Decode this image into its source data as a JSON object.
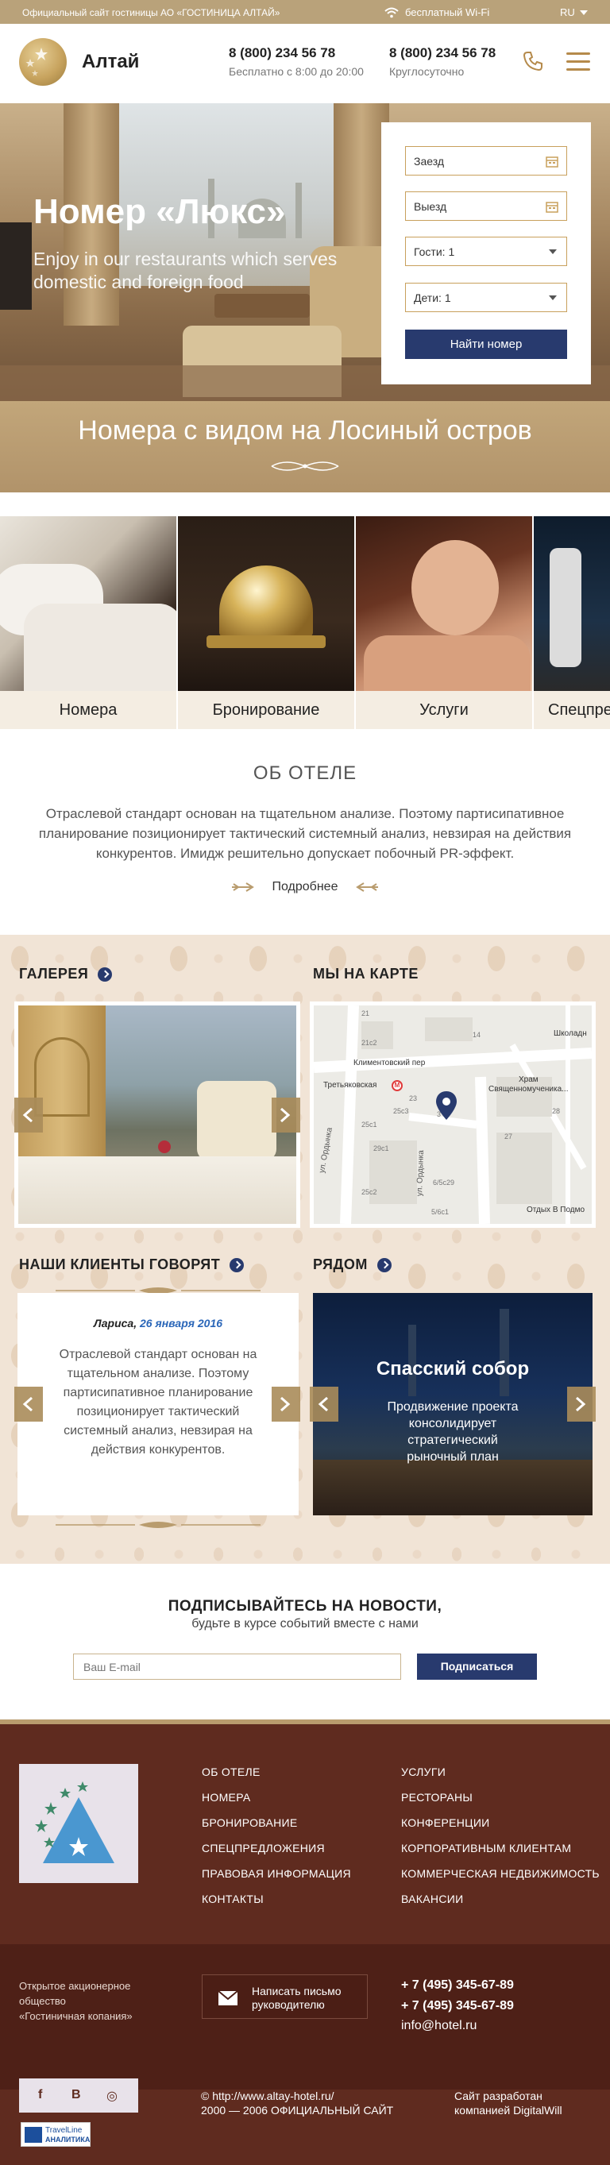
{
  "topbar": {
    "official": "Официальный сайт гостиницы АО «ГОСТИНИЦА АЛТАЙ»",
    "wifi": "бесплатный Wi-Fi",
    "lang": "RU"
  },
  "header": {
    "logo_text": "Алтай",
    "phones": [
      {
        "number": "8 (800) 234 56 78",
        "note": "Бесплатно с 8:00 до 20:00"
      },
      {
        "number": "8 (800) 234 56 78",
        "note": "Круглосуточно"
      }
    ],
    "icons": [
      "phone-icon",
      "menu-icon"
    ]
  },
  "hero": {
    "title": "Номер «Люкс»",
    "subtitle": "Enjoy in our restaurants which serves domestic and foreign food",
    "booking": {
      "checkin": "Заезд",
      "checkout": "Выезд",
      "guests": "Гости: 1",
      "children": "Дети: 1",
      "button": "Найти номер"
    }
  },
  "banner": {
    "text": "Номера с видом на Лосиный остров"
  },
  "tiles": [
    {
      "label": "Номера"
    },
    {
      "label": "Бронирование"
    },
    {
      "label": "Услуги"
    },
    {
      "label": "Спецпредложения"
    }
  ],
  "about": {
    "title": "ОБ ОТЕЛЕ",
    "text": "Отраслевой стандарт основан на тщательном анализе. Поэтому партисипативное планирование позиционирует тактический системный анализ, невзирая на действия конкурентов. Имидж решительно допускает побочный PR-эффект.",
    "more": "Подробнее"
  },
  "gallery": {
    "title": "ГАЛЕРЕЯ"
  },
  "map": {
    "title": "МЫ НА КАРТЕ",
    "labels": [
      "21",
      "21с2",
      "14",
      "Школадн",
      "Климентовский пер",
      "Третьяковская",
      "Храм",
      "Священномученика...",
      "23",
      "25с3",
      "27",
      "28",
      "25с1",
      "29с1",
      "25с2",
      "6/5с29",
      "3",
      "ул. Ордынка",
      "ул. Ордынка",
      "5/6с1",
      "Отдых В Подмо"
    ]
  },
  "reviews": {
    "title": "НАШИ КЛИЕНТЫ ГОВОРЯТ",
    "name": "Лариса,",
    "date": "26 января 2016",
    "text": "Отраслевой стандарт основан на тщательном анализе. Поэтому партисипативное планирование позиционирует тактический системный анализ, невзирая на действия конкурентов."
  },
  "nearby": {
    "title": "РЯДОМ",
    "place": "Спасский собор",
    "text": "Продвижение проекта консолидирует стратегический рыночный план"
  },
  "subscribe": {
    "title": "ПОДПИСЫВАЙТЕСЬ НА НОВОСТИ,",
    "note": "будьте в курсе событий вместе с нами",
    "placeholder": "Ваш  E-mail",
    "button": "Подписаться"
  },
  "footer": {
    "col1": [
      "ОБ ОТЕЛЕ",
      "НОМЕРА",
      "БРОНИРОВАНИЕ",
      "СПЕЦПРЕДЛОЖЕНИЯ",
      "ПРАВОВАЯ ИНФОРМАЦИЯ",
      "КОНТАКТЫ"
    ],
    "col2": [
      "УСЛУГИ",
      "РЕСТОРАНЫ",
      "КОНФЕРЕНЦИИ",
      "КОРПОРАТИВНЫМ КЛИЕНТАМ",
      "КОММЕРЧЕСКАЯ НЕДВИЖИМОСТЬ",
      "ВАКАНСИИ"
    ],
    "company": [
      "Открытое акционерное",
      "общество",
      "«Гостиничная копания»"
    ],
    "letter": "Написать письмо руководителю",
    "phones": [
      "+ 7 (495) 345-67-89",
      "+ 7 (495) 345-67-89"
    ],
    "email": "info@hotel.ru",
    "social": [
      "f",
      "В",
      "◎"
    ],
    "copy_line1": "© http://www.altay-hotel.ru/",
    "copy_line2": "2000 — 2006  ОФИЦИАЛЬНЫЙ САЙТ",
    "dev_line1": "Сайт разработан",
    "dev_line2": "компанией DigitalWill",
    "travel_line1": "TravelLine",
    "travel_line2": "АНАЛИТИКА"
  },
  "colors": {
    "gold": "#b9a27a",
    "navy": "#283a6e",
    "footer": "#5f2b1f",
    "cream": "#f4ede2"
  }
}
